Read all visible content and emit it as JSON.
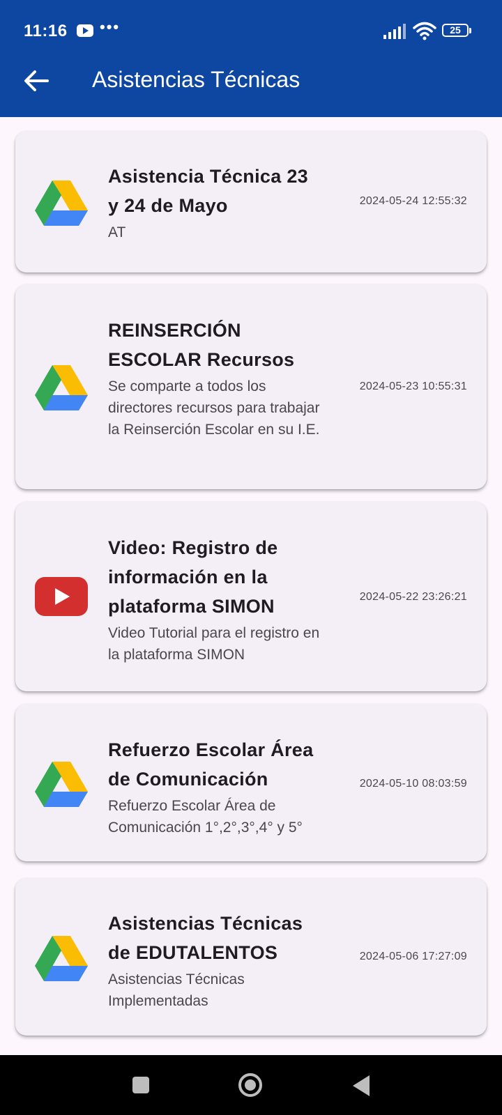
{
  "status_bar": {
    "time": "11:16",
    "dots": "•••",
    "battery": "25"
  },
  "app_bar": {
    "title": "Asistencias Técnicas",
    "color": "#0d47a1"
  },
  "items": [
    {
      "icon": "google-drive-icon",
      "title": "Asistencia Técnica 23 y 24 de Mayo",
      "subtitle": "AT",
      "date": "2024-05-24 12:55:32"
    },
    {
      "icon": "google-drive-icon",
      "title": "REINSERCIÓN ESCOLAR Recursos",
      "subtitle": "Se comparte a todos los directores recursos para trabajar la Reinserción Escolar en su I.E.",
      "date": "2024-05-23 10:55:31"
    },
    {
      "icon": "youtube-icon",
      "title": "Video: Registro de información en la plataforma SIMON",
      "subtitle": "Video Tutorial para el registro en la plataforma SIMON",
      "date": "2024-05-22 23:26:21"
    },
    {
      "icon": "google-drive-icon",
      "title": "Refuerzo Escolar Área de Comunicación",
      "subtitle": "Refuerzo Escolar Área de Comunicación 1°,2°,3°,4° y 5°",
      "date": "2024-05-10 08:03:59"
    },
    {
      "icon": "google-drive-icon",
      "title": "Asistencias Técnicas de EDUTALENTOS",
      "subtitle": "Asistencias Técnicas Implementadas",
      "date": "2024-05-06 17:27:09"
    }
  ]
}
